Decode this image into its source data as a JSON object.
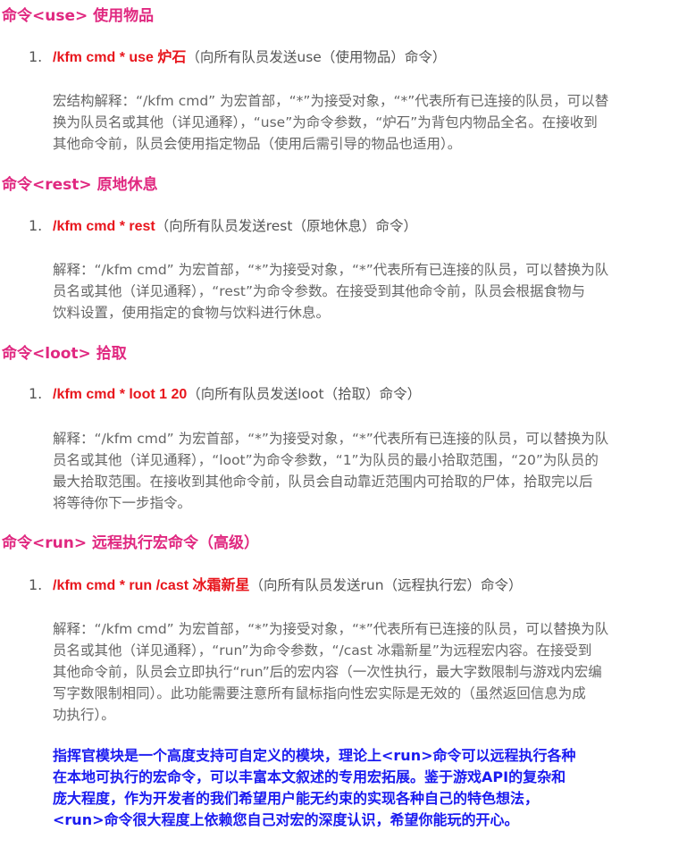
{
  "sections": [
    {
      "title": "命令<use> 使用物品",
      "num": "1.",
      "cmd": "/kfm cmd * use 炉石",
      "desc": "（向所有队员发送use（使用物品）命令）",
      "lines": [
        "宏结构解释：“/kfm cmd” 为宏首部，“*”为接受对象，“*”代表所有已连接的队员，可以替",
        "换为队员名或其他（详见通释），“use”为命令参数，“炉石”为背包内物品全名。在接收到",
        "其他命令前，队员会使用指定物品（使用后需引导的物品也适用）。"
      ]
    },
    {
      "title": "命令<rest> 原地休息",
      "num": "1.",
      "cmd": "/kfm cmd * rest",
      "desc": "（向所有队员发送rest（原地休息）命令）",
      "lines": [
        "解释：“/kfm cmd” 为宏首部，“*”为接受对象，“*”代表所有已连接的队员，可以替换为队",
        "员名或其他（详见通释），“rest”为命令参数。在接受到其他命令前，队员会根据食物与",
        "饮料设置，使用指定的食物与饮料进行休息。"
      ]
    },
    {
      "title": "命令<loot> 拾取",
      "num": "1.",
      "cmd": "/kfm cmd * loot 1 20",
      "desc": "（向所有队员发送loot（拾取）命令）",
      "lines": [
        "解释：“/kfm cmd” 为宏首部，“*”为接受对象，“*”代表所有已连接的队员，可以替换为队",
        "员名或其他（详见通释），“loot”为命令参数，“1”为队员的最小拾取范围，“20”为队员的",
        "最大拾取范围。在接收到其他命令前，队员会自动靠近范围内可拾取的尸体，拾取完以后",
        "将等待你下一步指令。"
      ]
    },
    {
      "title": "命令<run>  远程执行宏命令（高级）",
      "num": "1.",
      "cmd": "/kfm cmd * run /cast 冰霜新星",
      "desc": "（向所有队员发送run（远程执行宏）命令）",
      "lines": [
        "解释：“/kfm cmd” 为宏首部，“*”为接受对象，“*”代表所有已连接的队员，可以替换为队",
        "员名或其他（详见通释），“run”为命令参数，“/cast 冰霜新星”为远程宏内容。在接受到",
        "其他命令前，队员会立即执行“run”后的宏内容（一次性执行，最大字数限制与游戏内宏编",
        "写字数限制相同）。此功能需要注意所有鼠标指向性宏实际是无效的（虽然返回信息为成",
        "功执行）。"
      ]
    }
  ],
  "note_lines": [
    "指挥官模块是一个高度支持可自定义的模块，理论上<run>命令可以远程执行各种",
    "在本地可执行的宏命令，可以丰富本文叙述的专用宏拓展。鉴于游戏API的复杂和",
    "庞大程度，作为开发者的我们希望用户能无约束的实现各种自己的特色想法，",
    "<run>命令很大程度上依赖您自己对宏的深度认识，希望你能玩的开心。"
  ],
  "colors": {
    "section_title": "#e02880",
    "command": "#e8161d",
    "body_text": "#666666",
    "note": "#1a1af0"
  }
}
